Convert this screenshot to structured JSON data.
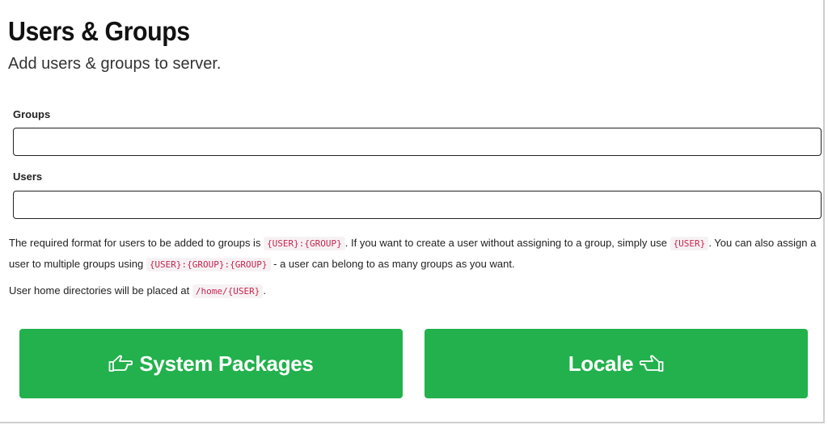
{
  "header": {
    "title": "Users & Groups",
    "subtitle": "Add users & groups to server."
  },
  "form": {
    "groups_label": "Groups",
    "groups_value": "",
    "users_label": "Users",
    "users_value": ""
  },
  "help": {
    "p1_a": "The required format for users to be added to groups is ",
    "p1_code1": "{USER}:{GROUP}",
    "p1_b": ". If you want to create a user without assigning to a group, simply use ",
    "p1_code2": "{USER}",
    "p1_c": ". You can also assign a user to multiple groups using ",
    "p1_code3": "{USER}:{GROUP}:{GROUP}",
    "p1_d": " - a user can belong to as many groups as you want.",
    "p2_a": "User home directories will be placed at ",
    "p2_code": "/home/{USER}",
    "p2_b": "."
  },
  "nav": {
    "prev_label": "System Packages",
    "prev_icon": "hand-point-left-icon",
    "next_label": "Locale",
    "next_icon": "hand-point-right-icon",
    "button_color": "#22b14c"
  }
}
